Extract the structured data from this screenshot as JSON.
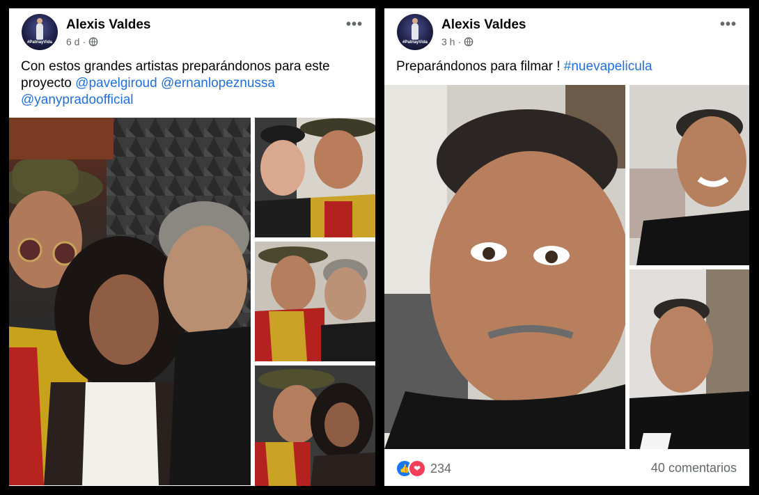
{
  "left_post": {
    "author": "Alexis Valdes",
    "avatar_tag": "#PatriayVida",
    "time": "6 d",
    "audience_icon": "globe-icon",
    "more_icon": "more-options-icon",
    "more_text": "•••",
    "caption_text": "Con estos grandes artistas preparándonos para este proyecto",
    "mentions": [
      "@pavelgiroud",
      "@ernanlopeznussa",
      "@yanypradoofficial"
    ],
    "photo_count": 4
  },
  "right_post": {
    "author": "Alexis Valdes",
    "avatar_tag": "#PatriayVida",
    "time": "3 h",
    "audience_icon": "globe-icon",
    "more_icon": "more-options-icon",
    "more_text": "•••",
    "caption_text": "Preparándonos para filmar !",
    "hashtag": "#nuevapelicula",
    "photo_count": 3,
    "reactions": {
      "icons": [
        "like-icon",
        "love-icon"
      ],
      "like_glyph": "👍",
      "love_glyph": "❤",
      "count": "234"
    },
    "comments": "40 comentarios"
  },
  "colors": {
    "link": "#216fdb",
    "like": "#1877f2",
    "love": "#f33e58",
    "meta_text": "#65676b"
  }
}
